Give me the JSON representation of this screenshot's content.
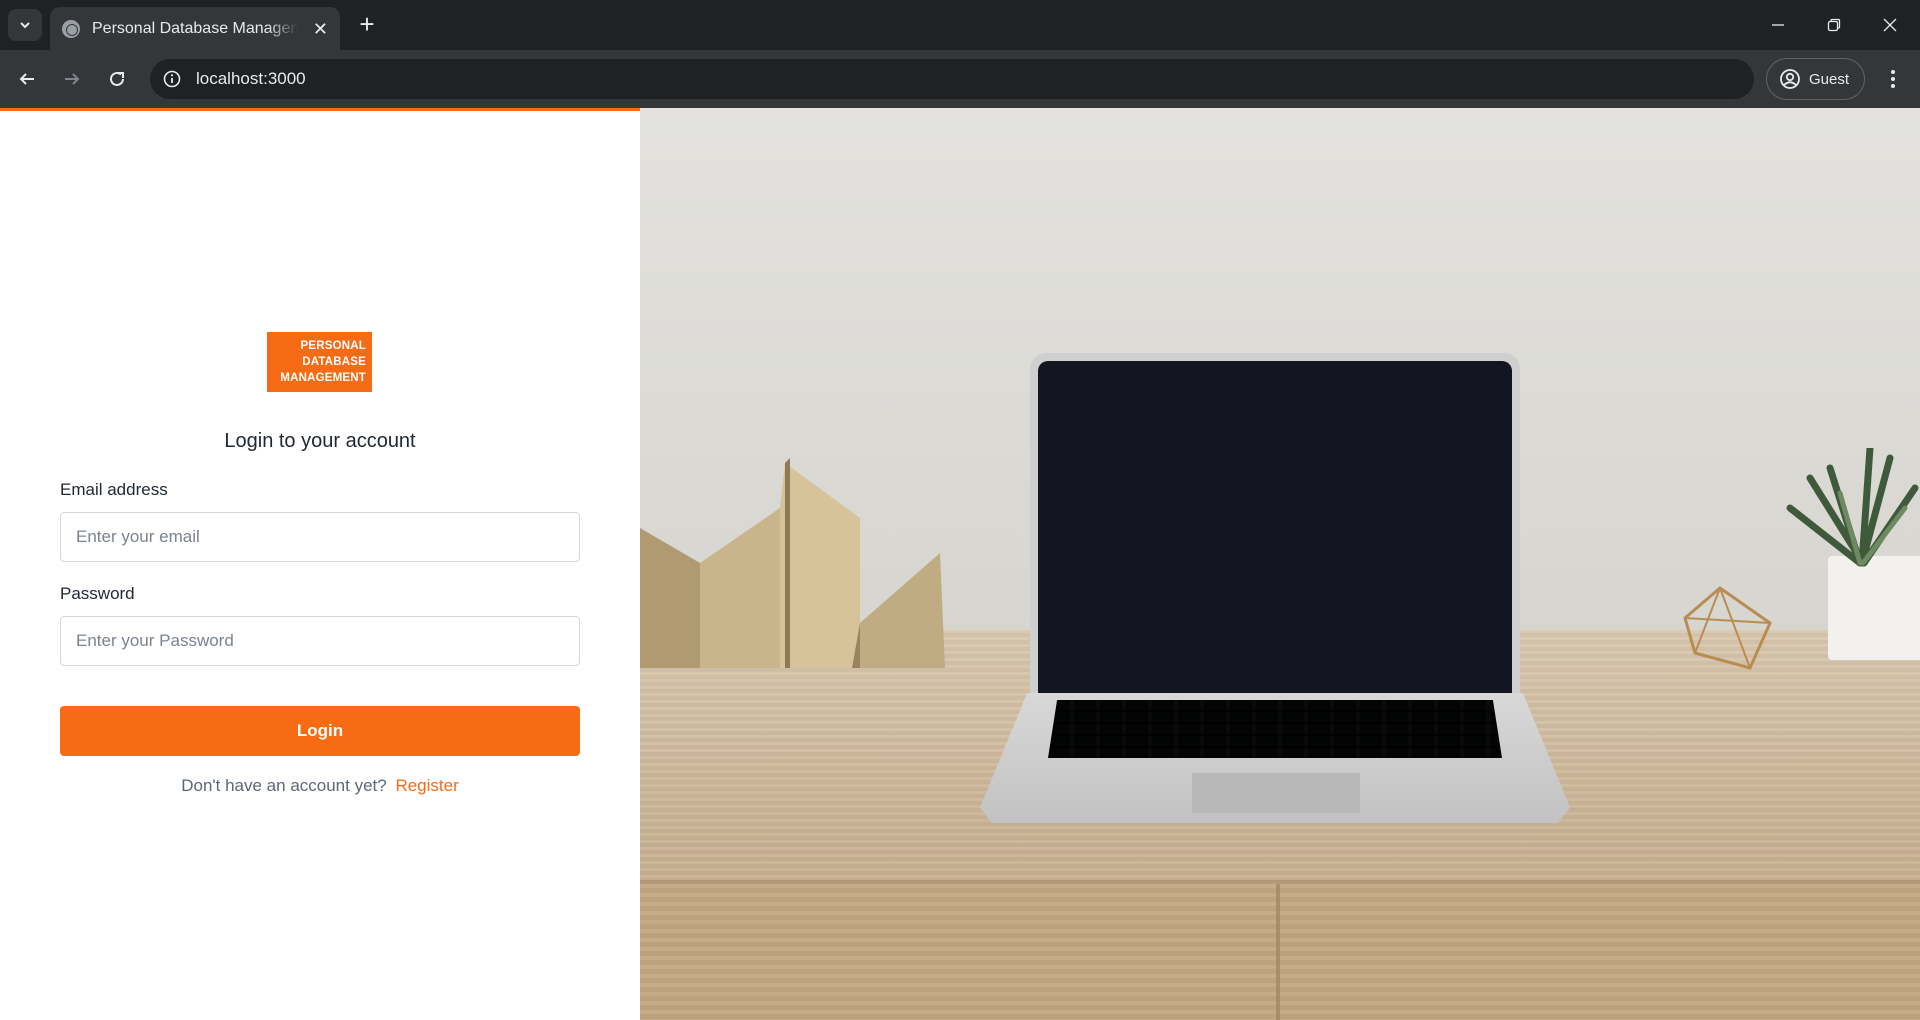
{
  "browser": {
    "tab_title": "Personal Database Management",
    "tab_close": "✕",
    "new_tab": "+",
    "url": "localhost:3000",
    "profile_label": "Guest"
  },
  "logo": {
    "line1": "PERSONAL",
    "line2": "DATABASE",
    "line3": "MANAGEMENT"
  },
  "login": {
    "heading": "Login to your account",
    "email_label": "Email address",
    "email_placeholder": "Enter your email",
    "email_value": "",
    "password_label": "Password",
    "password_placeholder": "Enter your Password",
    "password_value": "",
    "submit_label": "Login",
    "register_prompt": "Don't have an account yet?",
    "register_link": "Register"
  },
  "colors": {
    "accent": "#f76b15",
    "text": "#1f2733",
    "muted": "#5d6677",
    "chrome_dark": "#202124",
    "chrome_toolbar": "#35363a"
  },
  "icons": {
    "tab_search": "chevron-down-icon",
    "favicon": "globe-icon",
    "back": "arrow-left-icon",
    "forward": "arrow-right-icon",
    "reload": "reload-icon",
    "site_info": "info-icon",
    "profile": "account-circle-icon",
    "menu": "kebab-menu-icon",
    "minimize": "minimize-icon",
    "restore": "restore-icon",
    "close": "close-icon"
  }
}
